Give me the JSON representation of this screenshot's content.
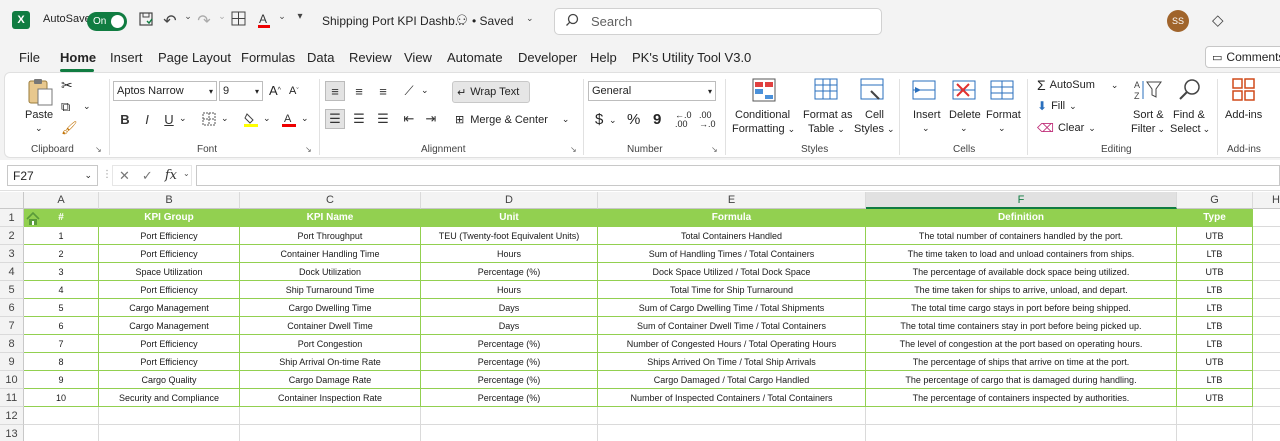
{
  "titlebar": {
    "app_icon": "X",
    "autosave_label": "AutoSave",
    "autosave_state": "On",
    "doc_title": "Shipping Port KPI Dashb...",
    "saved_label": "• Saved",
    "search_placeholder": "Search",
    "avatar_initials": "SS"
  },
  "menu": {
    "tabs": [
      "File",
      "Home",
      "Insert",
      "Page Layout",
      "Formulas",
      "Data",
      "Review",
      "View",
      "Automate",
      "Developer",
      "Help",
      "PK's Utility Tool V3.0"
    ],
    "active": "Home",
    "comments_label": "Comments"
  },
  "ribbon": {
    "clipboard": {
      "paste_label": "Paste",
      "group_label": "Clipboard"
    },
    "font": {
      "font_name": "Aptos Narrow",
      "font_size": "9",
      "bold": "B",
      "italic": "I",
      "underline": "U",
      "group_label": "Font"
    },
    "alignment": {
      "wrap_text": "Wrap Text",
      "merge_center": "Merge & Center",
      "group_label": "Alignment"
    },
    "number": {
      "format": "General",
      "currency": "$",
      "percent": "%",
      "comma": "9",
      "group_label": "Number"
    },
    "styles": {
      "conditional": "Conditional",
      "formatting": "Formatting",
      "format_as": "Format as",
      "table": "Table",
      "cell": "Cell",
      "styles": "Styles",
      "group_label": "Styles"
    },
    "cells": {
      "insert": "Insert",
      "delete": "Delete",
      "format": "Format",
      "group_label": "Cells"
    },
    "editing": {
      "autosum": "AutoSum",
      "fill": "Fill",
      "clear": "Clear",
      "sort_filter_1": "Sort &",
      "sort_filter_2": "Filter",
      "find_select_1": "Find &",
      "find_select_2": "Select",
      "group_label": "Editing"
    },
    "addins": {
      "label": "Add-ins",
      "group_label": "Add-ins"
    }
  },
  "formula_bar": {
    "name_box": "F27",
    "fx": "fx",
    "content": ""
  },
  "columns": [
    "A",
    "B",
    "C",
    "D",
    "E",
    "F",
    "G",
    "H"
  ],
  "selected_column": "F",
  "table": {
    "headers": [
      "#",
      "KPI Group",
      "KPI Name",
      "Unit",
      "Formula",
      "Definition",
      "Type"
    ],
    "rows": [
      [
        "1",
        "Port Efficiency",
        "Port Throughput",
        "TEU (Twenty-foot Equivalent Units)",
        "Total Containers Handled",
        "The total number of containers handled by the port.",
        "UTB"
      ],
      [
        "2",
        "Port Efficiency",
        "Container Handling Time",
        "Hours",
        "Sum of Handling Times / Total Containers",
        "The time taken to load and unload containers from ships.",
        "LTB"
      ],
      [
        "3",
        "Space Utilization",
        "Dock Utilization",
        "Percentage (%)",
        "Dock Space Utilized / Total Dock Space",
        "The percentage of available dock space being utilized.",
        "UTB"
      ],
      [
        "4",
        "Port Efficiency",
        "Ship Turnaround Time",
        "Hours",
        "Total Time for Ship Turnaround",
        "The time taken for ships to arrive, unload, and depart.",
        "LTB"
      ],
      [
        "5",
        "Cargo Management",
        "Cargo Dwelling Time",
        "Days",
        "Sum of Cargo Dwelling Time / Total Shipments",
        "The total time cargo stays in port before being shipped.",
        "LTB"
      ],
      [
        "6",
        "Cargo Management",
        "Container Dwell Time",
        "Days",
        "Sum of Container Dwell Time / Total Containers",
        "The total time containers stay in port before being picked up.",
        "LTB"
      ],
      [
        "7",
        "Port Efficiency",
        "Port Congestion",
        "Percentage (%)",
        "Number of Congested Hours / Total Operating Hours",
        "The level of congestion at the port based on operating hours.",
        "LTB"
      ],
      [
        "8",
        "Port Efficiency",
        "Ship Arrival On-time Rate",
        "Percentage (%)",
        "Ships Arrived On Time / Total Ship Arrivals",
        "The percentage of ships that arrive on time at the port.",
        "UTB"
      ],
      [
        "9",
        "Cargo Quality",
        "Cargo Damage Rate",
        "Percentage (%)",
        "Cargo Damaged / Total Cargo Handled",
        "The percentage of cargo that is damaged during handling.",
        "LTB"
      ],
      [
        "10",
        "Security and Compliance",
        "Container Inspection Rate",
        "Percentage (%)",
        "Number of Inspected Containers / Total Containers",
        "The percentage of containers inspected by authorities.",
        "UTB"
      ]
    ]
  },
  "row_numbers": [
    "1",
    "2",
    "3",
    "4",
    "5",
    "6",
    "7",
    "8",
    "9",
    "10",
    "11",
    "12",
    "13"
  ],
  "colors": {
    "accent": "#107c41",
    "header_fill": "#92d050"
  }
}
